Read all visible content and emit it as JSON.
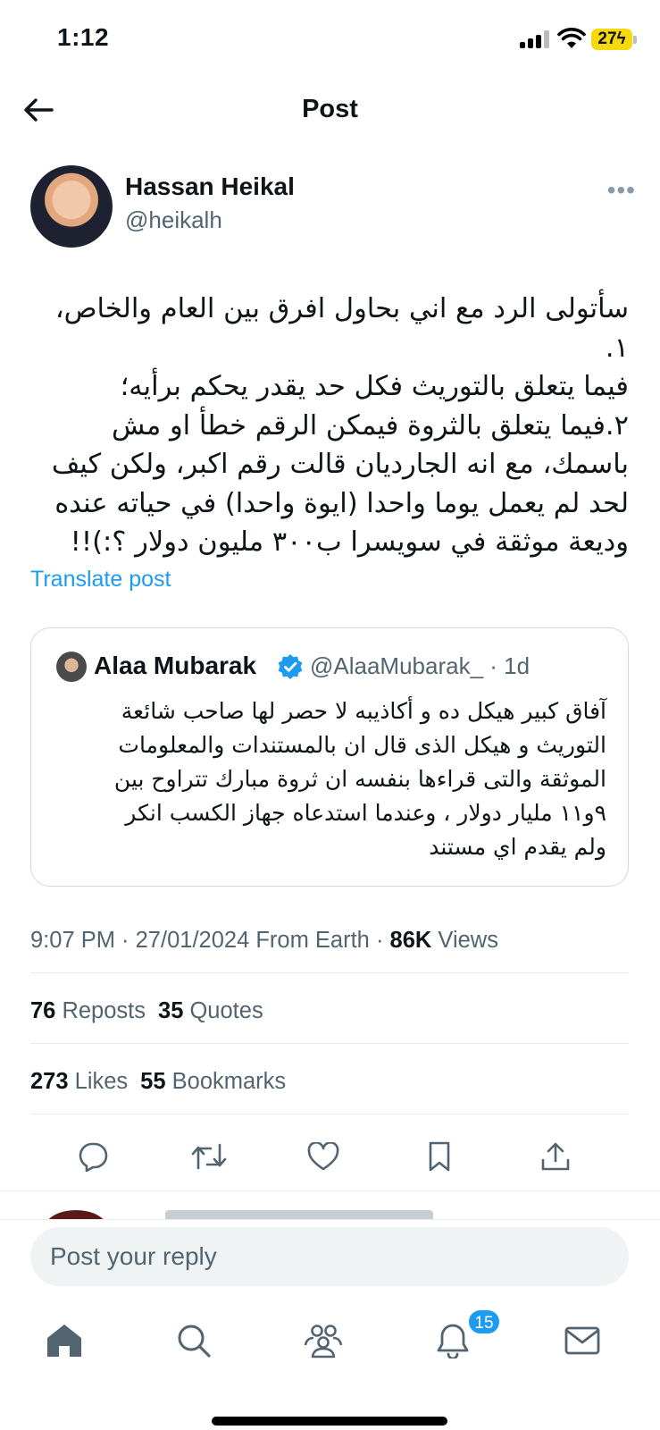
{
  "status_bar": {
    "time": "1:12",
    "battery": "27"
  },
  "header": {
    "title": "Post"
  },
  "author": {
    "name": "Hassan Heikal",
    "handle": "@heikalh"
  },
  "post": {
    "text": "سأتولى الرد مع اني بحاول افرق بين العام والخاص، ١.\nفيما يتعلق بالتوريث فكل حد يقدر يحكم برأيه؛\n٢.فيما يتعلق بالثروة فيمكن الرقم خطأ او مش\nباسمك، مع انه الجارديان قالت رقم اكبر، ولكن كيف\nلحد لم يعمل يوما واحدا (ايوة واحدا) في حياته عنده\nوديعة موثقة في سويسرا ب٣٠٠ مليون دولار ؟:)!!",
    "translate_label": "Translate post"
  },
  "quote": {
    "name": "Alaa Mubarak",
    "handle_time": "@AlaaMubarak_ · 1d",
    "text": "آفاق كبير هيكل ده و أكاذيبه لا حصر لها صاحب  شائعة\nالتوريث و هيكل الذى قال ان بالمستندات والمعلومات\nالموثقة والتى قراءها بنفسه ان ثروة مبارك تتراوح بين\n٩و١١ مليار دولار ، وعندما استدعاه جهاز الكسب انكر\nولم يقدم اي مستند"
  },
  "meta": {
    "time_date_source": "9:07 PM · 27/01/2024 From Earth · ",
    "views_count": "86K",
    "views_label": " Views"
  },
  "stats": {
    "reposts_count": "76",
    "reposts_label": " Reposts",
    "quotes_count": "35",
    "quotes_label": " Quotes",
    "likes_count": "273",
    "likes_label": " Likes",
    "bookmarks_count": "55",
    "bookmarks_label": " Bookmarks"
  },
  "reply": {
    "placeholder": "Post your reply"
  },
  "tabbar": {
    "notifications_badge": "15"
  },
  "colors": {
    "accent": "#1d9bf0",
    "secondary_text": "#536471",
    "battery": "#f5d90a"
  },
  "icons": [
    "back-arrow-icon",
    "more-icon",
    "verified-icon",
    "reply-icon",
    "repost-icon",
    "like-icon",
    "bookmark-icon",
    "share-icon",
    "home-icon",
    "search-icon",
    "communities-icon",
    "notifications-icon",
    "messages-icon"
  ]
}
